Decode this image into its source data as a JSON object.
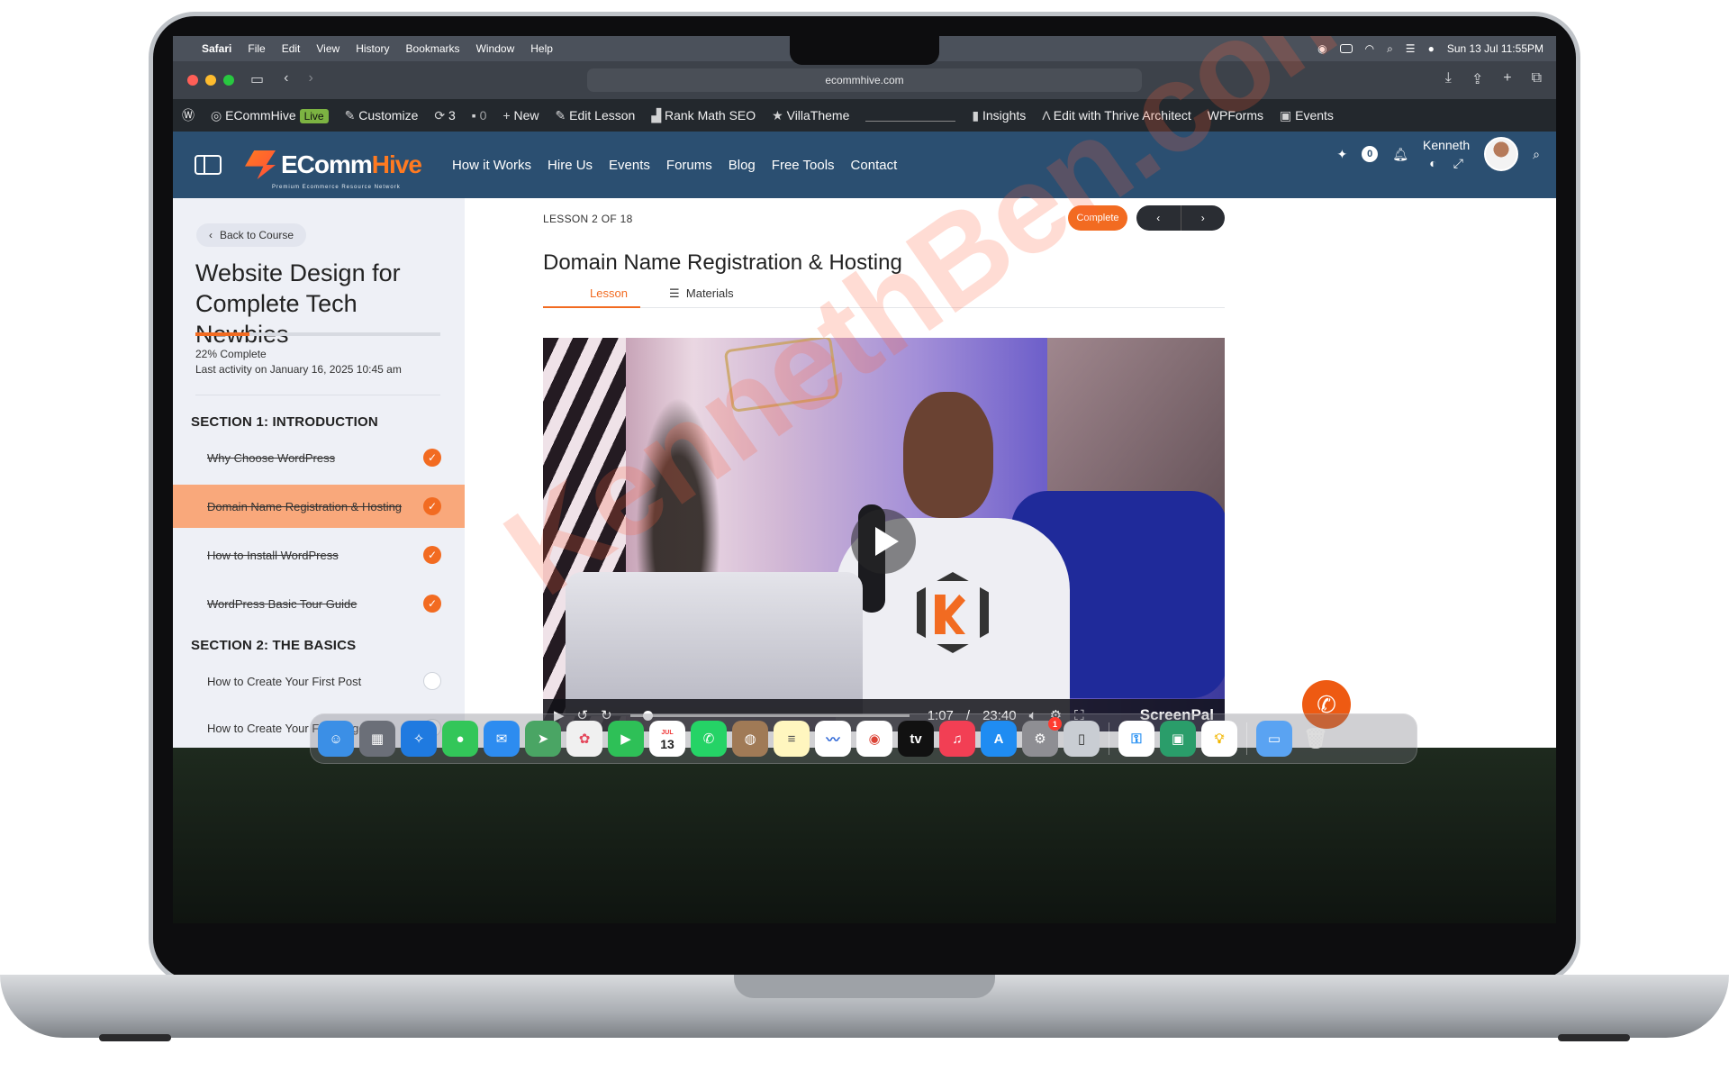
{
  "menubar": {
    "app": "Safari",
    "items": [
      "File",
      "Edit",
      "View",
      "History",
      "Bookmarks",
      "Window",
      "Help"
    ],
    "datetime": "Sun 13 Jul  11:55PM"
  },
  "safari": {
    "url": "ecommhive.com"
  },
  "wp_admin_bar": {
    "site": "ECommHive",
    "live": "Live",
    "customize": "Customize",
    "updates": "3",
    "comments": "0",
    "new": "New",
    "edit_lesson": "Edit Lesson",
    "rank_math": "Rank Math SEO",
    "villa_theme": "VillaTheme",
    "insights": "Insights",
    "thrive": "Edit with Thrive Architect",
    "wpforms": "WPForms",
    "events": "Events"
  },
  "site_header": {
    "logo_main": "EComm",
    "logo_accent": "Hive",
    "logo_sub": "Premium Ecommerce Resource Network",
    "nav": [
      "How it Works",
      "Hire Us",
      "Events",
      "Forums",
      "Blog",
      "Free Tools",
      "Contact"
    ],
    "notifications": "0",
    "user": "Kenneth"
  },
  "sidebar": {
    "back": "Back to Course",
    "course_title": "Website Design for Complete Tech Newbies",
    "progress_percent": 22,
    "progress_text": "22% Complete",
    "last_activity": "Last activity on January 16, 2025 10:45 am",
    "sections": [
      {
        "title": "SECTION 1: INTRODUCTION",
        "lessons": [
          {
            "label": "Why Choose WordPress",
            "done": true
          },
          {
            "label": "Domain Name Registration & Hosting",
            "done": true,
            "active": true
          },
          {
            "label": "How to Install WordPress",
            "done": true
          },
          {
            "label": "WordPress Basic Tour Guide",
            "done": true
          }
        ]
      },
      {
        "title": "SECTION 2: THE BASICS",
        "lessons": [
          {
            "label": "How to Create Your First Post",
            "done": false
          },
          {
            "label": "How to Create Your First Page",
            "done": false
          }
        ]
      }
    ]
  },
  "main": {
    "lesson_counter": "LESSON 2 OF 18",
    "complete_btn": "Complete",
    "prev": "‹",
    "next": "›",
    "title": "Domain Name Registration & Hosting",
    "tab_lesson": "Lesson",
    "tab_materials": "Materials",
    "video": {
      "current": "1:07",
      "separator": "/",
      "duration": "23:40",
      "progress_fraction": 0.047,
      "brand": "ScreenPal"
    }
  },
  "watermark": "KennethBen.com",
  "dock": {
    "calendar_day": "13",
    "calendar_month": "JUL",
    "settings_badge": "1"
  }
}
